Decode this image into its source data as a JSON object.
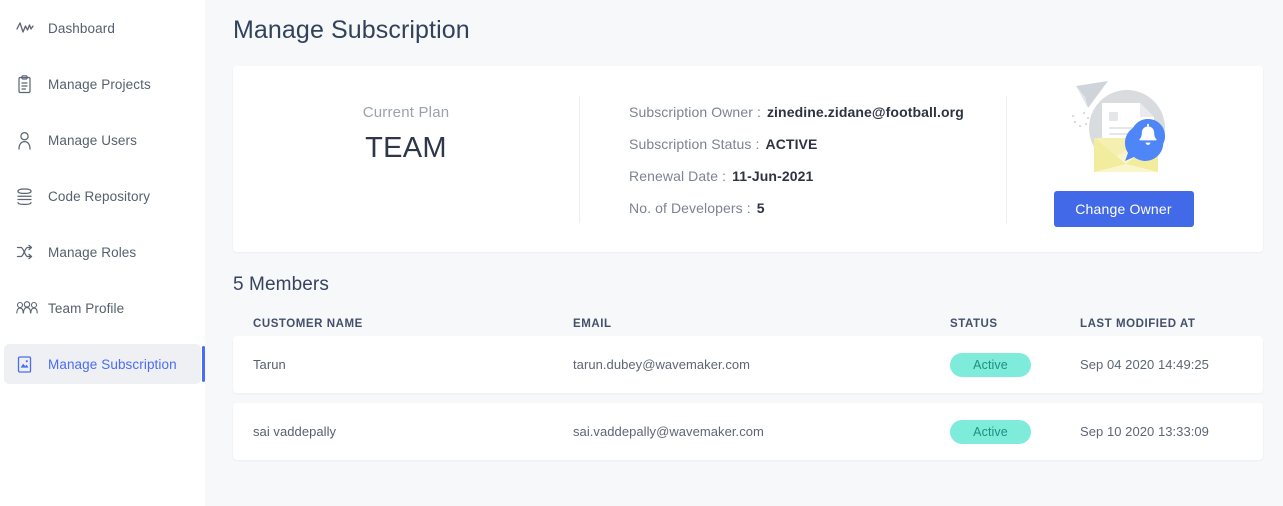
{
  "sidebar": {
    "items": [
      {
        "label": "Dashboard",
        "icon": "activity-pulse-icon",
        "active": false
      },
      {
        "label": "Manage Projects",
        "icon": "clipboard-icon",
        "active": false
      },
      {
        "label": "Manage Users",
        "icon": "user-icon",
        "active": false
      },
      {
        "label": "Code Repository",
        "icon": "layers-stack-icon",
        "active": false
      },
      {
        "label": "Manage Roles",
        "icon": "shuffle-icon",
        "active": false
      },
      {
        "label": "Team Profile",
        "icon": "group-people-icon",
        "active": false
      },
      {
        "label": "Manage Subscription",
        "icon": "subscription-card-icon",
        "active": true
      }
    ]
  },
  "header": {
    "title": "Manage Subscription"
  },
  "subscription_card": {
    "plan_label": "Current Plan",
    "plan_value": "TEAM",
    "details": [
      {
        "key": "Subscription Owner :",
        "value": "zinedine.zidane@football.org"
      },
      {
        "key": "Subscription Status :",
        "value": "ACTIVE"
      },
      {
        "key": "Renewal Date :",
        "value": "11-Jun-2021"
      },
      {
        "key": "No. of Developers :",
        "value": "5"
      }
    ],
    "change_owner_label": "Change Owner",
    "illustration": "envelope-notification-illustration"
  },
  "members": {
    "heading": "5 Members",
    "columns": [
      "CUSTOMER NAME",
      "EMAIL",
      "STATUS",
      "LAST MODIFIED AT"
    ],
    "rows": [
      {
        "name": "Tarun",
        "email": "tarun.dubey@wavemaker.com",
        "status": "Active",
        "last_modified": "Sep 04 2020 14:49:25"
      },
      {
        "name": "sai vaddepally",
        "email": "sai.vaddepally@wavemaker.com",
        "status": "Active",
        "last_modified": "Sep 10 2020 13:33:09"
      }
    ]
  },
  "colors": {
    "accent_blue": "#4a6cf7",
    "button_blue": "#4169e8",
    "badge_bg": "#7fecdb",
    "badge_text": "#1f8f80",
    "page_bg": "#f6f8fa"
  }
}
